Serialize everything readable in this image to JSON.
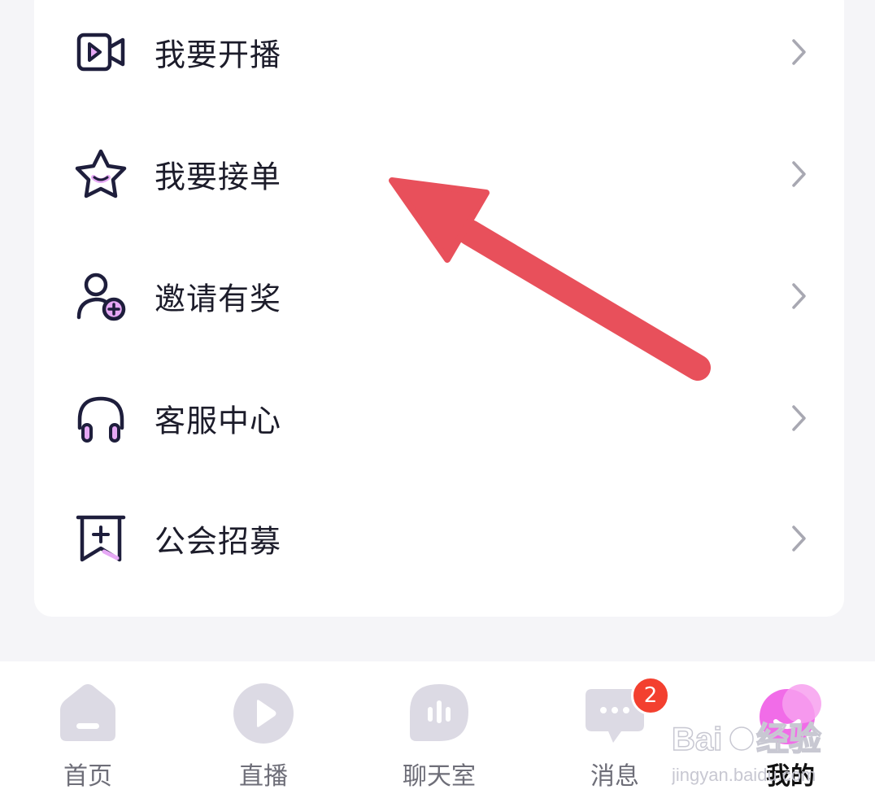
{
  "menu": {
    "items": [
      {
        "icon": "video-play-icon",
        "label": "我要开播"
      },
      {
        "icon": "star-smile-icon",
        "label": "我要接单"
      },
      {
        "icon": "user-add-icon",
        "label": "邀请有奖"
      },
      {
        "icon": "headphones-icon",
        "label": "客服中心"
      },
      {
        "icon": "bookmark-plus-icon",
        "label": "公会招募"
      }
    ]
  },
  "tabbar": {
    "tabs": [
      {
        "label": "首页",
        "icon": "home-icon",
        "active": false
      },
      {
        "label": "直播",
        "icon": "play-icon",
        "active": false
      },
      {
        "label": "聊天室",
        "icon": "voice-wave-icon",
        "active": false
      },
      {
        "label": "消息",
        "icon": "chat-bubble-icon",
        "active": false,
        "badge": "2"
      },
      {
        "label": "我的",
        "icon": "smile-blob-icon",
        "active": true
      }
    ]
  },
  "colors": {
    "icon_stroke": "#1e1e3c",
    "icon_accent": "#e6a8f5",
    "annotation_arrow": "#e8505b",
    "tab_inactive_icon": "#dcdae4",
    "tab_active_pink": "#f05ce6",
    "badge": "#f3402f"
  },
  "watermark": {
    "logo_text": "Baidu经验",
    "url_text": "jingyan.baidu.com"
  }
}
